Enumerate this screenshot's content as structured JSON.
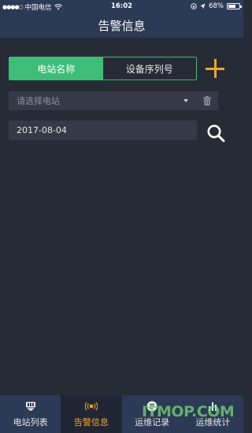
{
  "status_bar": {
    "signal_dots": "●●●●○",
    "carrier": "中国电信",
    "time": "16:02",
    "battery_percent": "68%",
    "battery_level": 0.68
  },
  "nav": {
    "title": "告警信息"
  },
  "segment": {
    "station_name": "电站名称",
    "device_serial": "设备序列号"
  },
  "select": {
    "placeholder": "请选择电站"
  },
  "date": {
    "value": "2017-08-04"
  },
  "tabs": [
    {
      "label": "电站列表",
      "icon": "station-list-icon"
    },
    {
      "label": "告警信息",
      "icon": "alarm-icon"
    },
    {
      "label": "运维记录",
      "icon": "maintenance-record-icon"
    },
    {
      "label": "运维统计",
      "icon": "maintenance-stats-icon"
    }
  ],
  "watermark": "ITMOP.COM",
  "colors": {
    "accent_green": "#3dbd76",
    "accent_orange": "#f0a430",
    "bar": "#2c3a55",
    "background": "#272b36"
  }
}
